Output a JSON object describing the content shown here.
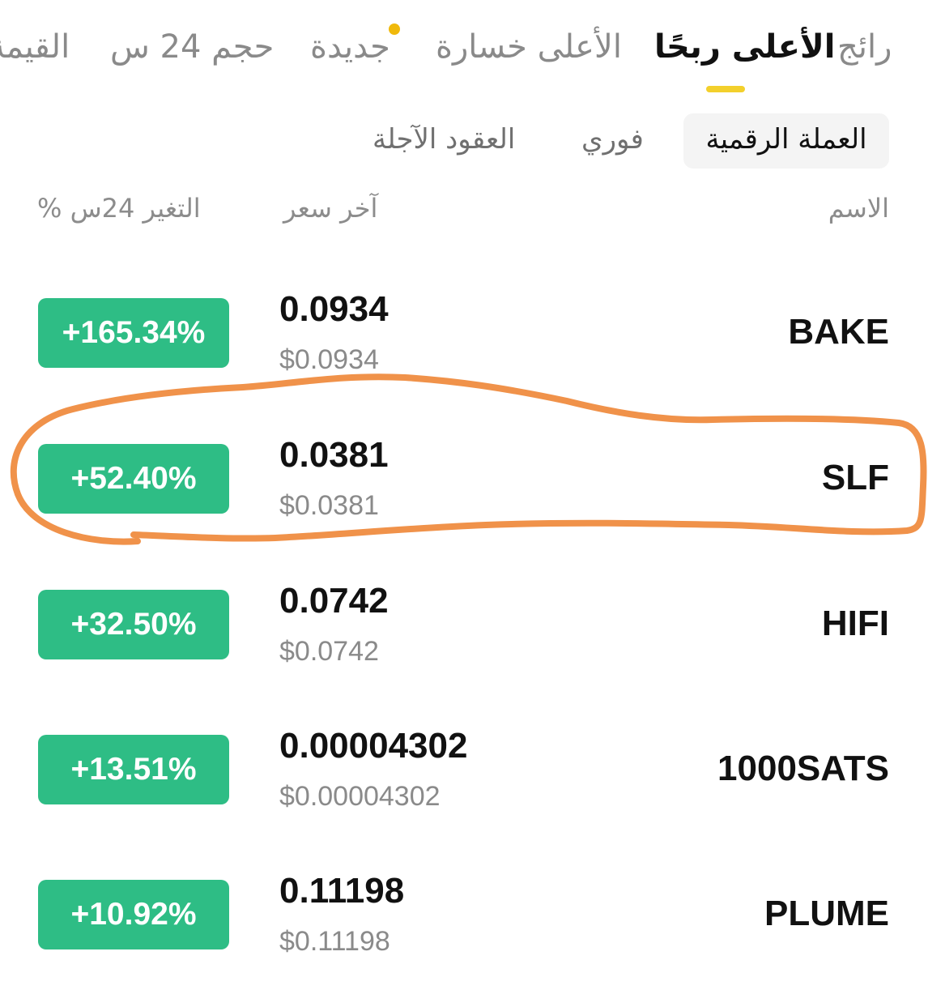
{
  "tabs": [
    {
      "label": "رائج",
      "active": false
    },
    {
      "label": "الأعلى ربحًا",
      "active": true
    },
    {
      "label": "الأعلى خسارة",
      "active": false
    },
    {
      "label": "جديدة",
      "active": false,
      "has_dot": true
    },
    {
      "label": "حجم 24 س",
      "active": false
    },
    {
      "label": "القيمة",
      "active": false
    }
  ],
  "sub_tabs": [
    {
      "label": "العملة الرقمية",
      "active": true
    },
    {
      "label": "فوري",
      "active": false
    },
    {
      "label": "العقود الآجلة",
      "active": false
    }
  ],
  "columns": {
    "name": "الاسم",
    "last_price": "آخر سعر",
    "change_24h": "% التغير 24س"
  },
  "rows": [
    {
      "symbol": "BAKE",
      "price": "0.0934",
      "usd_price": "$0.0934",
      "change": "+165.34%"
    },
    {
      "symbol": "SLF",
      "price": "0.0381",
      "usd_price": "$0.0381",
      "change": "+52.40%",
      "highlighted": true
    },
    {
      "symbol": "HIFI",
      "price": "0.0742",
      "usd_price": "$0.0742",
      "change": "+32.50%"
    },
    {
      "symbol": "1000SATS",
      "price": "0.00004302",
      "usd_price": "$0.00004302",
      "change": "+13.51%"
    },
    {
      "symbol": "PLUME",
      "price": "0.11198",
      "usd_price": "$0.11198",
      "change": "+10.92%"
    }
  ],
  "colors": {
    "positive": "#2ebd85",
    "accent_underline": "#f3d02c",
    "annotation": "#f0924a"
  }
}
